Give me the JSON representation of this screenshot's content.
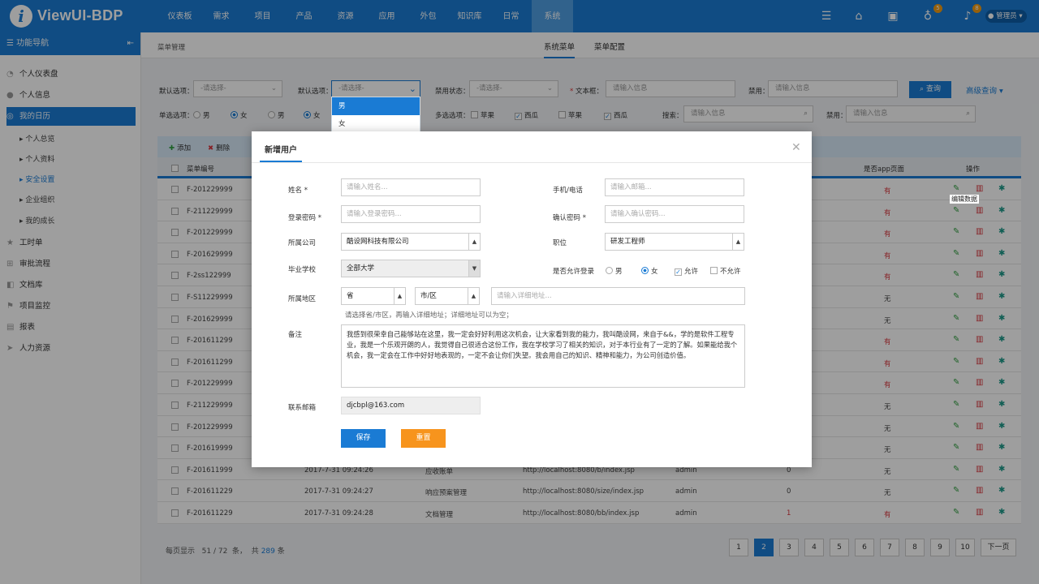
{
  "app": {
    "logo_letter": "i",
    "brand": "ViewUI-BDP"
  },
  "topnav": [
    "仪表板",
    "需求",
    "项目",
    "产品",
    "资源",
    "应用",
    "外包",
    "知识库",
    "日常",
    "系统"
  ],
  "topnav_active": "系统",
  "top_right": {
    "bulb_badge": "5",
    "bell_badge": "8",
    "user": "管理员"
  },
  "sidebar": {
    "title": "功能导航",
    "items": [
      "个人仪表盘",
      "个人信息",
      "我的日历"
    ],
    "active": "我的日历",
    "subitems": [
      "个人总览",
      "个人资料",
      "安全设置",
      "企业组织",
      "我的成长"
    ],
    "selected_sub": "安全设置",
    "more": [
      "工时单",
      "审批流程",
      "文档库",
      "项目监控",
      "报表",
      "人力资源"
    ]
  },
  "breadcrumb": "菜单管理",
  "tabs": [
    "系统菜单",
    "菜单配置"
  ],
  "filters": {
    "default_option_label": "默认选项：",
    "select_placeholder": "-请选择-",
    "disable_state_label": "禁用状态：",
    "textbox_label": "文本框：",
    "input_placeholder": "请输入信息",
    "disabled_label": "禁用：",
    "single_label": "单选选项：",
    "male": "男",
    "female": "女",
    "multi_label": "多选选项：",
    "apple": "苹果",
    "melon": "西瓜",
    "search_label": "搜索：",
    "query_button": "查询",
    "advanced": "高级查询"
  },
  "dropdown_options": [
    "男",
    "女"
  ],
  "toolbar": {
    "add": "添加",
    "delete": "删除"
  },
  "table": {
    "headers": {
      "code": "菜单编号",
      "app": "是否app页面",
      "ops": "操作"
    },
    "rows": [
      {
        "code": "F-201229999",
        "app": "有"
      },
      {
        "code": "F-211229999",
        "app": "有"
      },
      {
        "code": "F-201229999",
        "app": "有"
      },
      {
        "code": "F-201629999",
        "app": "有"
      },
      {
        "code": "F-2ss122999",
        "app": "有"
      },
      {
        "code": "F-S11229999",
        "app": "无"
      },
      {
        "code": "F-201629999",
        "app": "无"
      },
      {
        "code": "F-201611299",
        "app": "有"
      },
      {
        "code": "F-201611299",
        "app": "有"
      },
      {
        "code": "F-201229999",
        "app": "有"
      },
      {
        "code": "F-211229999",
        "app": "无"
      },
      {
        "code": "F-201229999",
        "app": "无"
      },
      {
        "code": "F-201619999",
        "app": "无"
      },
      {
        "code": "F-201611999",
        "time": "2017-7-31 09:24:26",
        "name": "应收账单",
        "url": "http://localhost:8080/b/index.jsp",
        "user": "admin",
        "num": "0",
        "app": "无"
      },
      {
        "code": "F-201611229",
        "time": "2017-7-31 09:24:27",
        "name": "响应预案管理",
        "url": "http://localhost:8080/size/index.jsp",
        "user": "admin",
        "num": "0",
        "app": "无"
      },
      {
        "code": "F-201611229",
        "time": "2017-7-31 09:24:28",
        "name": "文档管理",
        "url": "http://localhost:8080/bb/index.jsp",
        "user": "admin",
        "num": "1",
        "app": "有"
      }
    ],
    "tooltip": "编辑数据"
  },
  "footer": {
    "per_page": "每页显示",
    "page_size": "51",
    "slash": "/",
    "pages": "72",
    "unit1": "条，",
    "total_label": "共",
    "total": "289",
    "unit2": "条"
  },
  "pagination": {
    "pages": [
      "1",
      "2",
      "3",
      "4",
      "5",
      "6",
      "7",
      "8",
      "9",
      "10"
    ],
    "current": "2",
    "next": "下一页"
  },
  "modal": {
    "title": "新增用户",
    "name_label": "姓名",
    "name_placeholder": "请输入姓名...",
    "phone_label": "手机/电话",
    "phone_placeholder": "请输入邮箱...",
    "pwd_label": "登录密码",
    "pwd_placeholder": "请输入登录密码...",
    "confirm_label": "确认密码",
    "confirm_placeholder": "请输入确认密码...",
    "company_label": "所属公司",
    "company_value": "酷设网科技有限公司",
    "position_label": "职位",
    "position_value": "研发工程师",
    "school_label": "毕业学校",
    "school_value": "全部大学",
    "login_label": "是否允许登录",
    "male": "男",
    "female": "女",
    "allow": "允许",
    "deny": "不允许",
    "region_label": "所属地区",
    "province": "省",
    "city": "市/区",
    "address_placeholder": "请输入详细地址...",
    "region_hint": "请选择省/市区，再输入详细地址；详细地址可以为空；",
    "note_label": "备注",
    "note_text": "我感到很荣幸自己能够站在这里，我一定会好好利用这次机会，让大家看到我的能力，我叫酷设网，来自于&&，学的是软件工程专业，我是一个乐观开朗的人，我觉得自己很适合这份工作，我在学校学习了相关的知识，对于本行业有了一定的了解。如果能给我个机会，我一定会在工作中好好地表现的，一定不会让你们失望。我会用自己的知识、精神和能力，为公司创造价值。",
    "email_label": "联系邮箱",
    "email_value": "djcbpl@163.com",
    "save": "保存",
    "reset": "重置",
    "required_mark": "*"
  },
  "colors": {
    "primary": "#1a7bd4",
    "badge": "#f39c12",
    "reset_button": "#f7941d",
    "edit_icon": "#2e9e3e",
    "delete_icon": "#d9363e"
  }
}
